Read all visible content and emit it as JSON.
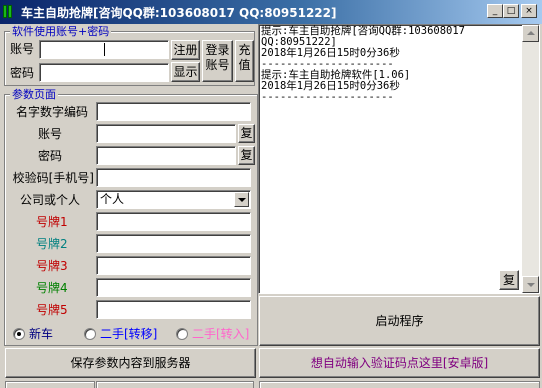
{
  "window": {
    "title": "车主自助抢牌[咨询QQ群:103608017 QQ:80951222]",
    "minimize_glyph": "_",
    "maximize_glyph": "□",
    "close_glyph": "×"
  },
  "account_group": {
    "legend": "软件使用账号+密码",
    "account_label": "账号",
    "account_value": "",
    "password_label": "密码",
    "password_value": "",
    "register_button": "注册",
    "show_button": "显示",
    "login_button_line1": "登录",
    "login_button_line2": "账号",
    "recharge_button_line1": "充",
    "recharge_button_line2": "值"
  },
  "params_group": {
    "legend": "参数页面",
    "name_code_label": "名字数字编码",
    "name_code_value": "",
    "account_label": "账号",
    "account_value": "",
    "password_label": "密码",
    "password_value": "",
    "copy_label": "复",
    "verify_label": "校验码[手机号]",
    "verify_value": "",
    "company_label": "公司或个人",
    "company_selected": "个人",
    "plates": [
      {
        "label": "号牌1",
        "value": "",
        "color": "#c00000"
      },
      {
        "label": "号牌2",
        "value": "",
        "color": "#008080"
      },
      {
        "label": "号牌3",
        "value": "",
        "color": "#c00000"
      },
      {
        "label": "号牌4",
        "value": "",
        "color": "#008000"
      },
      {
        "label": "号牌5",
        "value": "",
        "color": "#c00000"
      }
    ],
    "radio_new": "新车",
    "radio_used_transfer": "二手[转移]",
    "radio_used_transfer_in": "二手[转入]",
    "save_button": "保存参数内容到服务器"
  },
  "log": {
    "text": "提示:车主自助抢牌[咨询QQ群:103608017\nQQ:80951222]\n2018年1月26日15时0分36秒\n---------------------\n提示:车主自助抢牌软件[1.06]\n2018年1月26日15时0分36秒\n---------------------",
    "copy_label": "复"
  },
  "actions": {
    "start_button": "启动程序",
    "auto_captcha_button": "想自动输入验证码点这里[安卓版]"
  },
  "colors": {
    "legend_blue": "#0000c0",
    "radio_new": "#000080",
    "radio_used_transfer": "#0000ff",
    "radio_used_transfer_in": "#ff66cc",
    "auto_captcha": "#800080"
  }
}
